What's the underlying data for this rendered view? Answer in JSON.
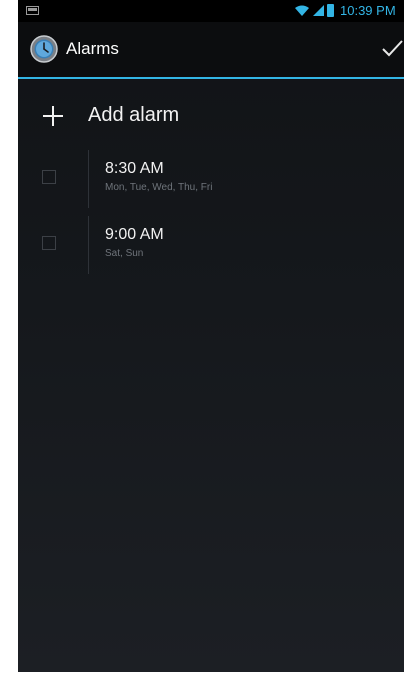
{
  "status_bar": {
    "time": "10:39 PM",
    "accent_color": "#33b5e5",
    "icons": [
      "notification-icon",
      "wifi-icon",
      "signal-icon",
      "battery-icon"
    ]
  },
  "action_bar": {
    "title": "Alarms",
    "app_icon": "clock-icon",
    "done_icon": "checkmark-icon"
  },
  "add_alarm": {
    "label": "Add alarm",
    "icon": "plus-icon"
  },
  "alarms": [
    {
      "time": "8:30 AM",
      "days": "Mon, Tue, Wed, Thu, Fri",
      "enabled": false
    },
    {
      "time": "9:00 AM",
      "days": "Sat, Sun",
      "enabled": false
    }
  ]
}
